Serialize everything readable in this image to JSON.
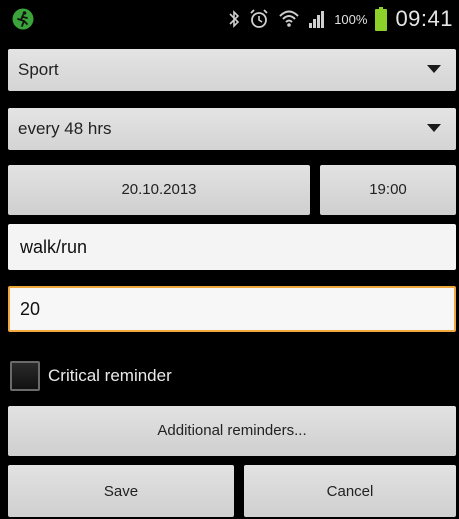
{
  "status_bar": {
    "app_icon": "running-man-icon",
    "icons": [
      "bluetooth-icon",
      "alarm-icon",
      "wifi-icon",
      "signal-icon",
      "battery-icon"
    ],
    "battery_percent": "100%",
    "time": "09:41"
  },
  "form": {
    "category": "Sport",
    "repeat": "every 48 hrs",
    "date": "20.10.2013",
    "time": "19:00",
    "title_value": "walk/run",
    "amount_value": "20",
    "critical_label": "Critical reminder",
    "critical_checked": false,
    "additional_label": "Additional reminders...",
    "save_label": "Save",
    "cancel_label": "Cancel"
  },
  "colors": {
    "background": "#000000",
    "focus_border": "#f0a83c",
    "battery_fill": "#8bd12a",
    "app_icon_bg": "#3aa33a"
  }
}
